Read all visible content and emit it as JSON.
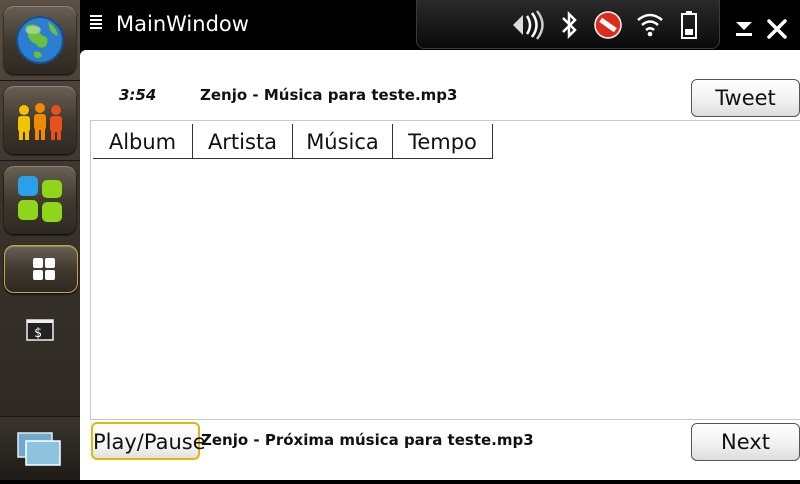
{
  "window": {
    "title": "MainWindow"
  },
  "dock": {
    "items": [
      {
        "name": "web-browser",
        "icon": "globe-icon"
      },
      {
        "name": "contacts",
        "icon": "people-icon"
      },
      {
        "name": "app-manager",
        "icon": "apps-grid-icon"
      },
      {
        "name": "dashboard",
        "icon": "dashboard-icon"
      },
      {
        "name": "terminal",
        "icon": "terminal-icon"
      },
      {
        "name": "task-switcher",
        "icon": "windows-icon"
      }
    ]
  },
  "status": {
    "icons": [
      "speaker-icon",
      "bluetooth-icon",
      "offline-icon",
      "wifi-icon",
      "battery-icon"
    ]
  },
  "player": {
    "time": "3:54",
    "now_playing": "Zenjo - Música para teste.mp3",
    "next_track": "Zenjo - Próxima música para teste.mp3",
    "tweet_label": "Tweet",
    "play_pause_label": "Play/Pause",
    "next_label": "Next"
  },
  "table": {
    "columns": [
      "Album",
      "Artista",
      "Música",
      "Tempo"
    ]
  },
  "colors": {
    "focus_border": "#e2b60a",
    "titlebar": "#000000",
    "content_bg": "#ffffff"
  }
}
